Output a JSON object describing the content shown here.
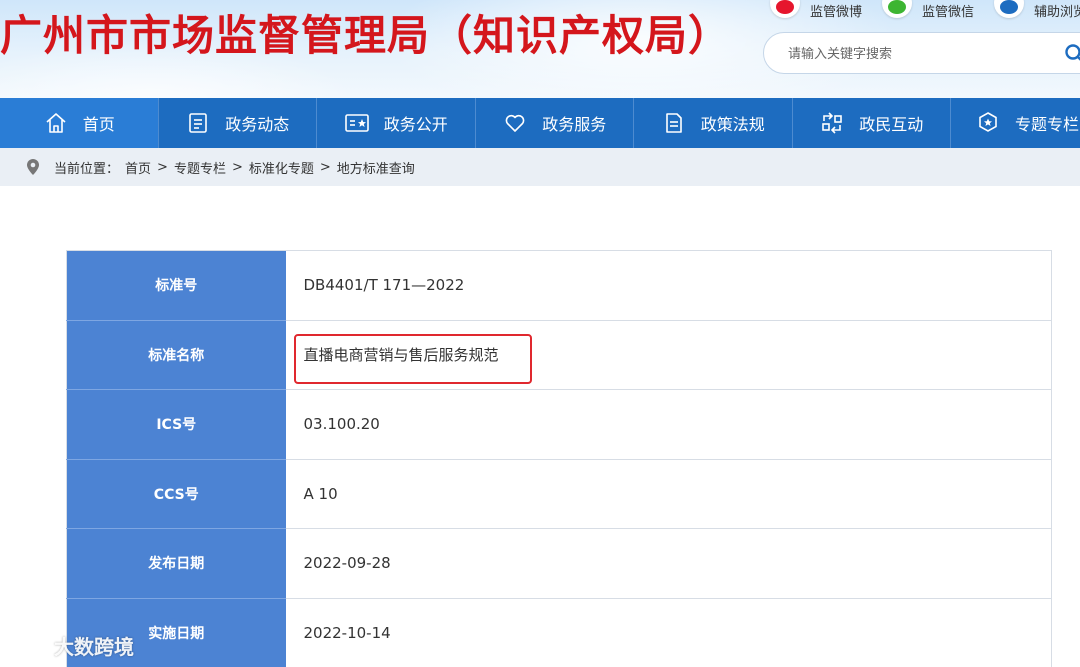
{
  "header": {
    "title": "广州市市场监督管理局（知识产权局）",
    "social": [
      {
        "label": "监管微博",
        "icon": "weibo-icon",
        "color": "#e6162d"
      },
      {
        "label": "监管微信",
        "icon": "wechat-icon",
        "color": "#3db532"
      },
      {
        "label": "辅助浏览",
        "icon": "accessibility-icon",
        "color": "#1d6cc0"
      }
    ],
    "search": {
      "placeholder": "请输入关键字搜索",
      "value": ""
    }
  },
  "nav": {
    "items": [
      {
        "label": "首页",
        "icon": "home-icon",
        "active": true
      },
      {
        "label": "政务动态",
        "icon": "document-list-icon"
      },
      {
        "label": "政务公开",
        "icon": "open-government-icon"
      },
      {
        "label": "政务服务",
        "icon": "heart-icon"
      },
      {
        "label": "政策法规",
        "icon": "policy-document-icon"
      },
      {
        "label": "政民互动",
        "icon": "interaction-icon"
      },
      {
        "label": "专题专栏",
        "icon": "badge-icon"
      }
    ]
  },
  "breadcrumb": {
    "prefix": "当前位置：",
    "items": [
      "首页",
      "专题专栏",
      "标准化专题",
      "地方标准查询"
    ],
    "separator": ">"
  },
  "detail": {
    "rows": [
      {
        "key": "标准号",
        "value": "DB4401/T 171—2022"
      },
      {
        "key": "标准名称",
        "value": "直播电商营销与售后服务规范"
      },
      {
        "key": "ICS号",
        "value": "03.100.20"
      },
      {
        "key": "CCS号",
        "value": "A 10"
      },
      {
        "key": "发布日期",
        "value": "2022-09-28"
      },
      {
        "key": "实施日期",
        "value": "2022-10-14"
      }
    ],
    "highlighted_row": "标准名称"
  },
  "watermark": {
    "text": "大数跨境",
    "icon": "brand-logo-icon"
  },
  "colors": {
    "nav_bg": "#1d6cc0",
    "title_red": "#d4161c",
    "key_cell_bg": "#4c83d3",
    "highlight_red": "#e0282e"
  }
}
